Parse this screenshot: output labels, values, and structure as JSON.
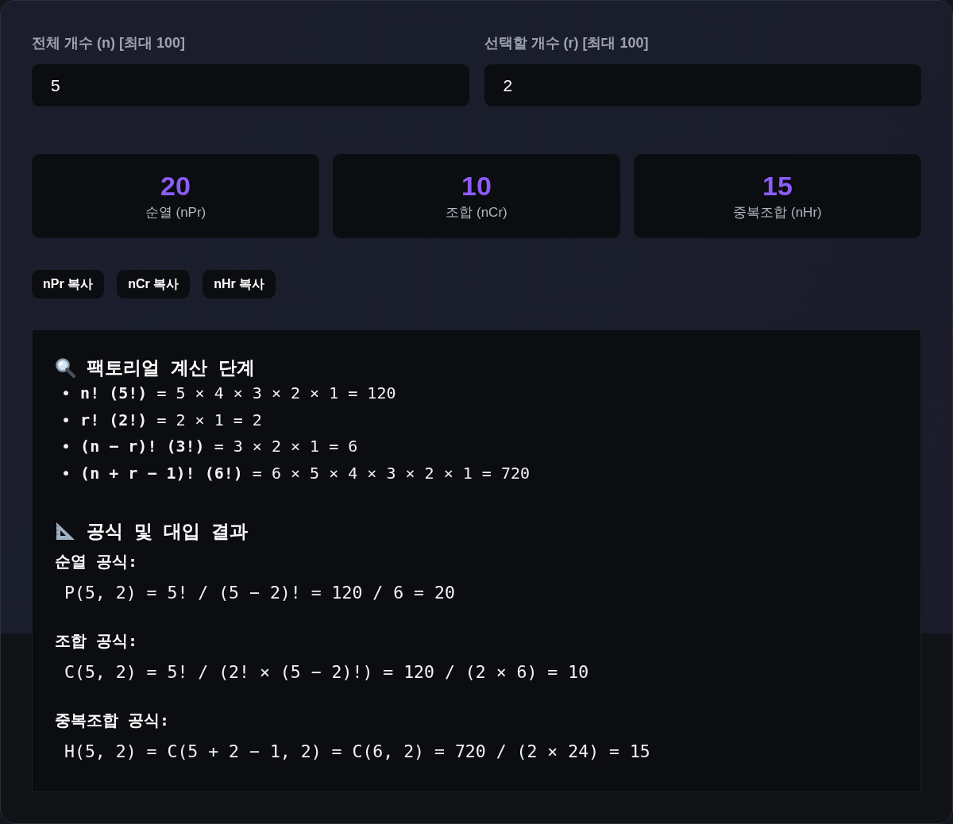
{
  "inputs": [
    {
      "label": "전체 개수 (n) [최대 100]",
      "value": "5"
    },
    {
      "label": "선택할 개수 (r) [최대 100]",
      "value": "2"
    }
  ],
  "results": [
    {
      "value": "20",
      "label": "순열 (nPr)"
    },
    {
      "value": "10",
      "label": "조합 (nCr)"
    },
    {
      "value": "15",
      "label": "중복조합 (nHr)"
    }
  ],
  "copy_buttons": [
    "nPr 복사",
    "nCr 복사",
    "nHr 복사"
  ],
  "details": {
    "factorial_section": {
      "title": "팩토리얼 계산 단계",
      "steps": [
        "• **n! (5!)** = 5 × 4 × 3 × 2 × 1 = 120",
        "• **r! (2!)** = 2 × 1 = 2",
        "• **(n − r)! (3!)** = 3 × 2 × 1 = 6",
        "• **(n + r − 1)! (6!)** = 6 × 5 × 4 × 3 × 2 × 1 = 720"
      ]
    },
    "formula_section": {
      "title": "공식 및 대입 결과",
      "formulas": [
        {
          "label": "순열 공식:",
          "expression": "P(5, 2) = 5! / (5 − 2)! = 120 / 6 = 20"
        },
        {
          "label": "조합 공식:",
          "expression": "C(5, 2) = 5! / (2! × (5 − 2)!) = 120 / (2 × 6) = 10"
        },
        {
          "label": "중복조합 공식:",
          "expression": "H(5, 2) = C(5 + 2 − 1, 2) = C(6, 2) = 720 / (2 × 24) = 15"
        }
      ]
    }
  }
}
